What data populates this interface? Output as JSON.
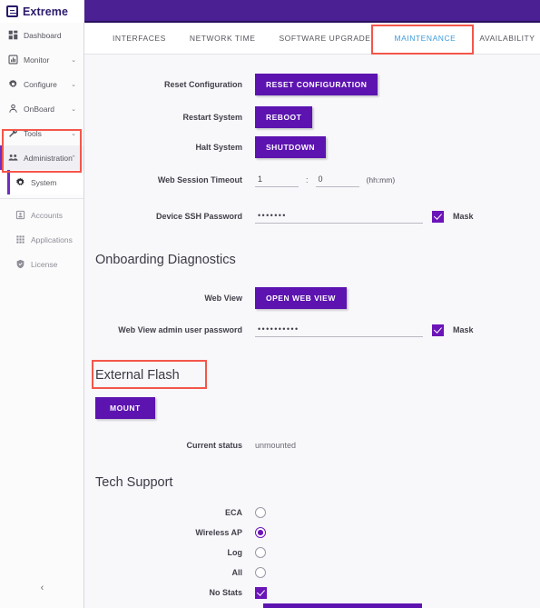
{
  "brand": {
    "name": "Extreme",
    "trademark": "®"
  },
  "sidebar": {
    "items": [
      {
        "label": "Dashboard",
        "icon": "dashboard-icon",
        "expandable": false,
        "chevron": ""
      },
      {
        "label": "Monitor",
        "icon": "monitor-icon",
        "expandable": true,
        "chevron": "⌄"
      },
      {
        "label": "Configure",
        "icon": "gear-icon",
        "expandable": true,
        "chevron": "⌄"
      },
      {
        "label": "OnBoard",
        "icon": "person-icon",
        "expandable": true,
        "chevron": "⌄"
      },
      {
        "label": "Tools",
        "icon": "wrench-icon",
        "expandable": true,
        "chevron": "⌄"
      },
      {
        "label": "Administration",
        "icon": "people-icon",
        "expandable": true,
        "chevron": "⌃"
      }
    ],
    "sub_items": [
      {
        "label": "System",
        "icon": "gear-icon",
        "selected": true
      },
      {
        "label": "Accounts",
        "icon": "id-card-icon",
        "selected": false
      },
      {
        "label": "Applications",
        "icon": "grid-icon",
        "selected": false
      },
      {
        "label": "License",
        "icon": "shield-icon",
        "selected": false
      }
    ],
    "collapse_glyph": "‹"
  },
  "tabs": [
    {
      "label": "INTERFACES",
      "active": false
    },
    {
      "label": "NETWORK TIME",
      "active": false
    },
    {
      "label": "SOFTWARE UPGRADE",
      "active": false
    },
    {
      "label": "MAINTENANCE",
      "active": true
    },
    {
      "label": "AVAILABILITY",
      "active": false
    }
  ],
  "maintenance": {
    "reset_configuration": {
      "label": "Reset Configuration",
      "button": "RESET CONFIGURATION"
    },
    "restart_system": {
      "label": "Restart System",
      "button": "REBOOT"
    },
    "halt_system": {
      "label": "Halt System",
      "button": "SHUTDOWN"
    },
    "web_session_timeout": {
      "label": "Web Session Timeout",
      "hours": "1",
      "minutes": "0",
      "separator": ":",
      "hint": "(hh:mm)"
    },
    "device_ssh_password": {
      "label": "Device SSH Password",
      "value": "•••••••",
      "mask_label": "Mask",
      "mask_checked": true
    }
  },
  "onboarding_diagnostics": {
    "heading": "Onboarding Diagnostics",
    "web_view": {
      "label": "Web View",
      "button": "OPEN WEB VIEW"
    },
    "admin_password": {
      "label": "Web View admin user password",
      "value": "••••••••••",
      "mask_label": "Mask",
      "mask_checked": true
    }
  },
  "external_flash": {
    "heading": "External Flash",
    "mount_button": "MOUNT",
    "status_label": "Current status",
    "status_value": "unmounted"
  },
  "tech_support": {
    "heading": "Tech Support",
    "options": [
      {
        "label": "ECA",
        "type": "radio",
        "selected": false
      },
      {
        "label": "Wireless AP",
        "type": "radio",
        "selected": true
      },
      {
        "label": "Log",
        "type": "radio",
        "selected": false
      },
      {
        "label": "All",
        "type": "radio",
        "selected": false
      },
      {
        "label": "No Stats",
        "type": "checkbox",
        "selected": true
      }
    ]
  },
  "colors": {
    "header_purple": "#4a2092",
    "button_purple": "#5c13b0",
    "accent_purple": "#6b14b8",
    "active_tab_blue": "#3e9bdd",
    "annotation_red": "#f4564a",
    "sidebar_bg": "#fbfbfc",
    "content_bg": "#f8f8fb"
  }
}
